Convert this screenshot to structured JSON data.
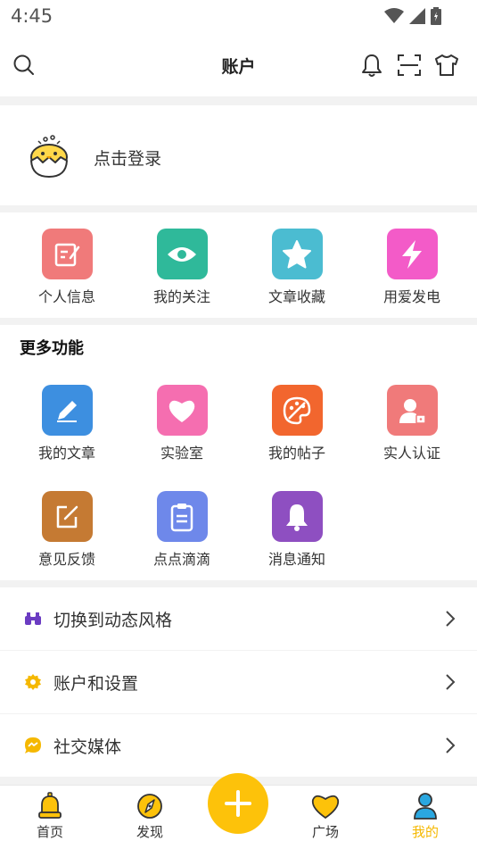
{
  "status_bar": {
    "time": "4:45"
  },
  "header": {
    "title": "账户"
  },
  "login": {
    "label": "点击登录"
  },
  "quick_actions": [
    {
      "label": "个人信息",
      "icon": "edit-note-icon",
      "color": "#f07a7a"
    },
    {
      "label": "我的关注",
      "icon": "eye-icon",
      "color": "#2fb99a"
    },
    {
      "label": "文章收藏",
      "icon": "star-icon",
      "color": "#4bbcd1"
    },
    {
      "label": "用爱发电",
      "icon": "lightning-icon",
      "color": "#f35bc8"
    }
  ],
  "more": {
    "title": "更多功能",
    "items": [
      {
        "label": "我的文章",
        "icon": "pencil-icon",
        "color": "#3d8fe0"
      },
      {
        "label": "实验室",
        "icon": "heart-icon",
        "color": "#f56eb0"
      },
      {
        "label": "我的帖子",
        "icon": "palette-icon",
        "color": "#f2662e"
      },
      {
        "label": "实人认证",
        "icon": "user-lock-icon",
        "color": "#f07a7a"
      },
      {
        "label": "意见反馈",
        "icon": "feedback-icon",
        "color": "#c57a33"
      },
      {
        "label": "点点滴滴",
        "icon": "clipboard-icon",
        "color": "#6e88ea"
      },
      {
        "label": "消息通知",
        "icon": "bell-icon",
        "color": "#8e4fc1"
      }
    ]
  },
  "settings_rows": [
    {
      "label": "切换到动态风格",
      "icon": "binoculars-icon",
      "color": "#6b3cc2"
    },
    {
      "label": "账户和设置",
      "icon": "gear-icon",
      "color": "#f5b800"
    },
    {
      "label": "社交媒体",
      "icon": "chat-bubble-icon",
      "color": "#f5b800"
    }
  ],
  "tabs": [
    {
      "label": "首页",
      "icon": "bell-tab-icon",
      "active": false
    },
    {
      "label": "发现",
      "icon": "compass-icon",
      "active": false
    },
    {
      "label": "广场",
      "icon": "heart-tab-icon",
      "active": false
    },
    {
      "label": "我的",
      "icon": "person-icon",
      "active": true
    }
  ],
  "colors": {
    "accent": "#fdc20a",
    "active_tab": "#f5b800"
  }
}
